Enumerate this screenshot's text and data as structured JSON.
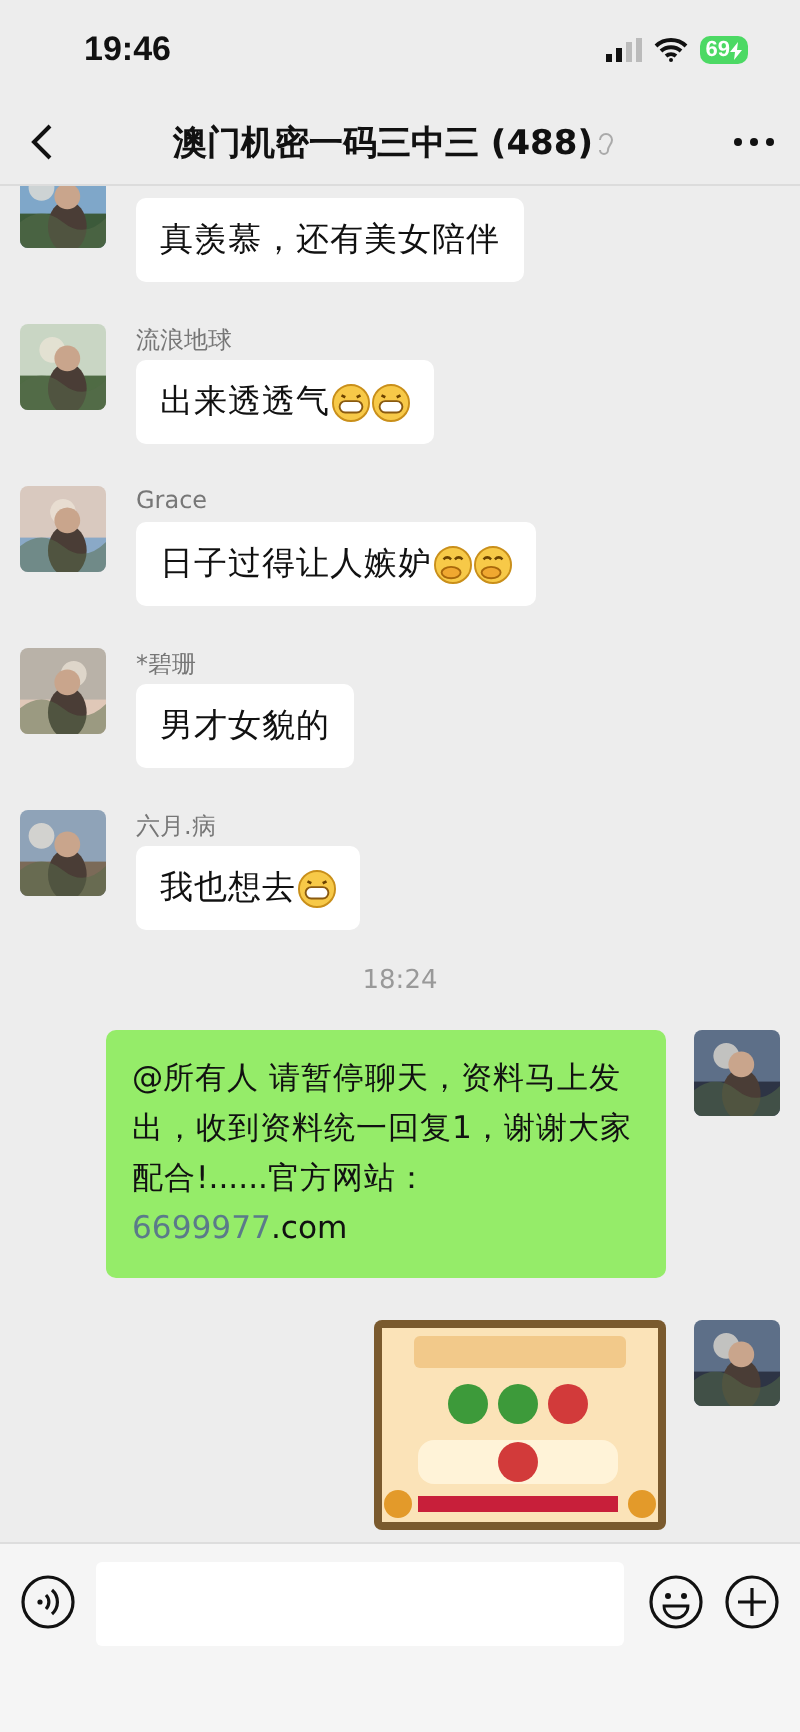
{
  "status_bar": {
    "time": "19:46",
    "battery": "69",
    "charging": true
  },
  "header": {
    "title": "澳门机密一码三中三 (488)",
    "muted": true
  },
  "messages": [
    {
      "kind": "incoming",
      "text": "真羡慕，还有美女陪伴"
    },
    {
      "kind": "incoming",
      "name": "流浪地球",
      "text": "出来透透气",
      "emojis": [
        {
          "kind": "grin"
        },
        {
          "kind": "grin"
        }
      ]
    },
    {
      "kind": "incoming",
      "name": "Grace",
      "text": "日子过得让人嫉妒",
      "emojis": [
        {
          "kind": "giggle"
        },
        {
          "kind": "giggle"
        }
      ]
    },
    {
      "kind": "incoming",
      "name": "*碧珊",
      "text": "男才女貌的"
    },
    {
      "kind": "incoming",
      "name": "六月.病",
      "text": "我也想去",
      "emojis": [
        {
          "kind": "grin"
        }
      ]
    },
    {
      "kind": "time",
      "text": "18:24"
    },
    {
      "kind": "outgoing",
      "text": "@所有人 请暂停聊天，资料马上发出，收到资料统一回复1，谢谢大家配合!......官方网站：",
      "link": "6699977",
      "text_after": ".com"
    },
    {
      "image": {
        "kind": "picture"
      }
    }
  ]
}
